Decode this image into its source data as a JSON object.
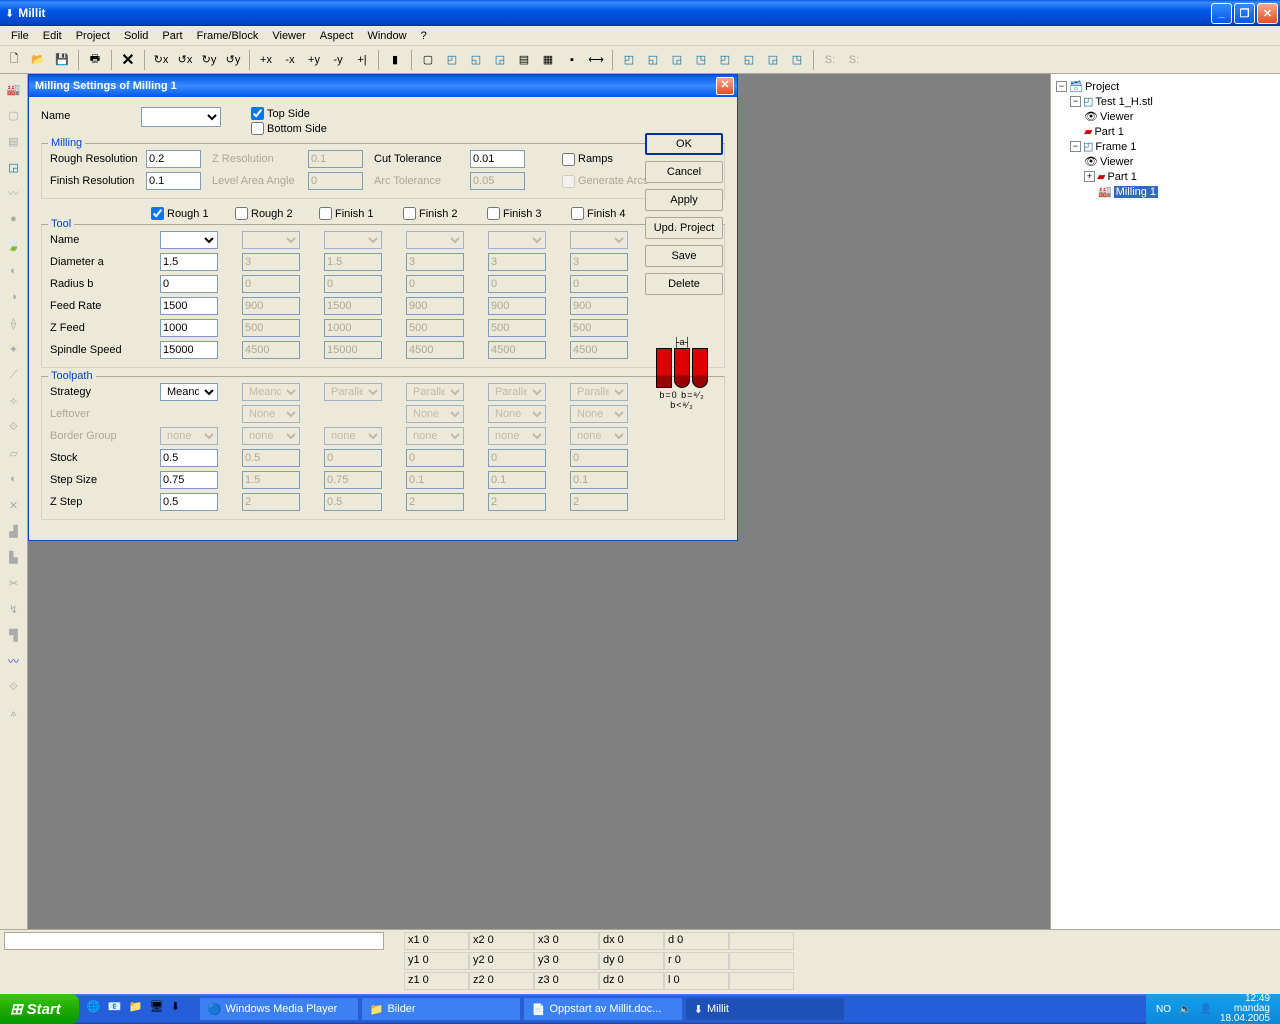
{
  "app": {
    "title": "Millit"
  },
  "menu": [
    "File",
    "Edit",
    "Project",
    "Solid",
    "Part",
    "Frame/Block",
    "Viewer",
    "Aspect",
    "Window",
    "?"
  ],
  "dialog": {
    "title": "Milling Settings of Milling 1",
    "name_label": "Name",
    "top_side": "Top Side",
    "bottom_side": "Bottom Side",
    "milling_legend": "Milling",
    "rough_res": "Rough Resolution",
    "rough_res_v": "0.2",
    "finish_res": "Finish Resolution",
    "finish_res_v": "0.1",
    "z_res": "Z Resolution",
    "z_res_v": "0.1",
    "level_area": "Level Area Angle",
    "level_area_v": "0",
    "cut_tol": "Cut Tolerance",
    "cut_tol_v": "0.01",
    "arc_tol": "Arc Tolerance",
    "arc_tol_v": "0.05",
    "ramps": "Ramps",
    "gen_arcs": "Generate Arcs",
    "passes": [
      "Rough 1",
      "Rough 2",
      "Finish 1",
      "Finish 2",
      "Finish 3",
      "Finish 4"
    ],
    "tool_legend": "Tool",
    "toolpath_legend": "Toolpath",
    "rows": {
      "name": "Name",
      "diameter": "Diameter a",
      "radius": "Radius b",
      "feed": "Feed Rate",
      "zfeed": "Z Feed",
      "spindle": "Spindle Speed",
      "strategy": "Strategy",
      "leftover": "Leftover",
      "border": "Border Group",
      "stock": "Stock",
      "step": "Step Size",
      "zstep": "Z Step"
    },
    "vals": {
      "diameter": [
        "1.5",
        "3",
        "1.5",
        "3",
        "3",
        "3"
      ],
      "radius": [
        "0",
        "0",
        "0",
        "0",
        "0",
        "0"
      ],
      "feed": [
        "1500",
        "900",
        "1500",
        "900",
        "900",
        "900"
      ],
      "zfeed": [
        "1000",
        "500",
        "1000",
        "500",
        "500",
        "500"
      ],
      "spindle": [
        "15000",
        "4500",
        "15000",
        "4500",
        "4500",
        "4500"
      ],
      "strategy": [
        "Meander",
        "Meander",
        "Parallel X",
        "Parallel X",
        "Parallel X",
        "Parallel X"
      ],
      "leftover": [
        "",
        "None",
        "",
        "None",
        "None",
        "None"
      ],
      "border": [
        "none",
        "none",
        "none",
        "none",
        "none",
        "none"
      ],
      "stock": [
        "0.5",
        "0.5",
        "0",
        "0",
        "0",
        "0"
      ],
      "step": [
        "0.75",
        "1.5",
        "0.75",
        "0.1",
        "0.1",
        "0.1"
      ],
      "zstep": [
        "0.5",
        "2",
        "0.5",
        "2",
        "2",
        "2"
      ]
    },
    "buttons": {
      "ok": "OK",
      "cancel": "Cancel",
      "apply": "Apply",
      "upd": "Upd. Project",
      "save": "Save",
      "delete": "Delete"
    },
    "tool_caption_top": "├a┤",
    "tool_caption": "b=0 b=ᵃ⁄₂ b<ᵃ⁄₂"
  },
  "tree": {
    "root": "Project",
    "items": [
      "Test 1_H.stl",
      "Viewer",
      "Part 1",
      "Frame 1",
      "Viewer",
      "Part 1",
      "Milling 1"
    ]
  },
  "status": {
    "coords": [
      [
        "x1",
        "0"
      ],
      [
        "x2",
        "0"
      ],
      [
        "x3",
        "0"
      ],
      [
        "dx",
        "0"
      ],
      [
        "d",
        "0"
      ],
      [
        "y1",
        "0"
      ],
      [
        "y2",
        "0"
      ],
      [
        "y3",
        "0"
      ],
      [
        "dy",
        "0"
      ],
      [
        "r",
        "0"
      ],
      [
        "z1",
        "0"
      ],
      [
        "z2",
        "0"
      ],
      [
        "z3",
        "0"
      ],
      [
        "dz",
        "0"
      ],
      [
        "l",
        "0"
      ]
    ]
  },
  "taskbar": {
    "start": "Start",
    "tasks": [
      "Windows Media Player",
      "Bilder",
      "Oppstart av Millit.doc...",
      "Millit"
    ],
    "lang": "NO",
    "time": "12:49",
    "day": "mandag",
    "date": "18.04.2005"
  }
}
